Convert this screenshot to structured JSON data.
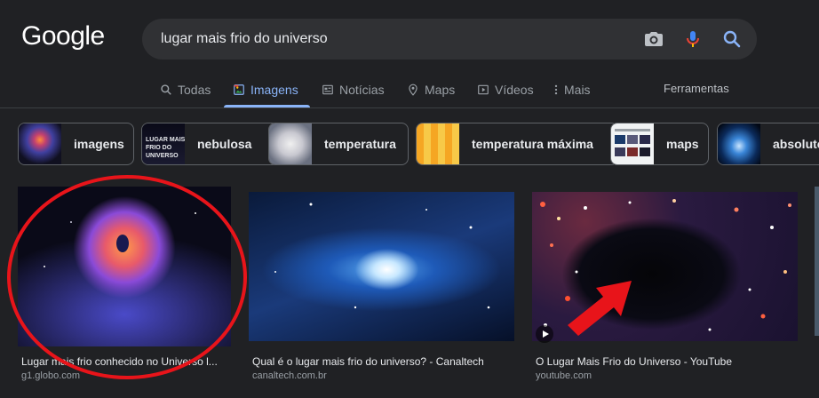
{
  "logo": {
    "text": "Google"
  },
  "search": {
    "query": "lugar mais frio do universo",
    "icons": [
      "camera-icon",
      "microphone-icon",
      "search-icon"
    ]
  },
  "tabs": [
    {
      "label": "Todas",
      "icon": "search-icon",
      "active": false
    },
    {
      "label": "Imagens",
      "icon": "image-icon",
      "active": true
    },
    {
      "label": "Notícias",
      "icon": "newspaper-icon",
      "active": false
    },
    {
      "label": "Maps",
      "icon": "map-pin-icon",
      "active": false
    },
    {
      "label": "Vídeos",
      "icon": "play-icon",
      "active": false
    },
    {
      "label": "Mais",
      "icon": "more-vert-icon",
      "active": false
    }
  ],
  "tools": {
    "label": "Ferramentas"
  },
  "chips": [
    {
      "label": "imagens"
    },
    {
      "label": "nebulosa"
    },
    {
      "label": "temperatura"
    },
    {
      "label": "temperatura máxima"
    },
    {
      "label": "maps"
    },
    {
      "label": "absoluto"
    }
  ],
  "results": [
    {
      "title": "Lugar mais frio conhecido no Universo l...",
      "source": "g1.globo.com"
    },
    {
      "title": "Qual é o lugar mais frio do universo? - Canaltech",
      "source": "canaltech.com.br"
    },
    {
      "title": "O Lugar Mais Frio do Universo - YouTube",
      "source": "youtube.com"
    }
  ],
  "colors": {
    "accent": "#8ab4f8",
    "background": "#202124",
    "annotation": "#e8141a"
  }
}
